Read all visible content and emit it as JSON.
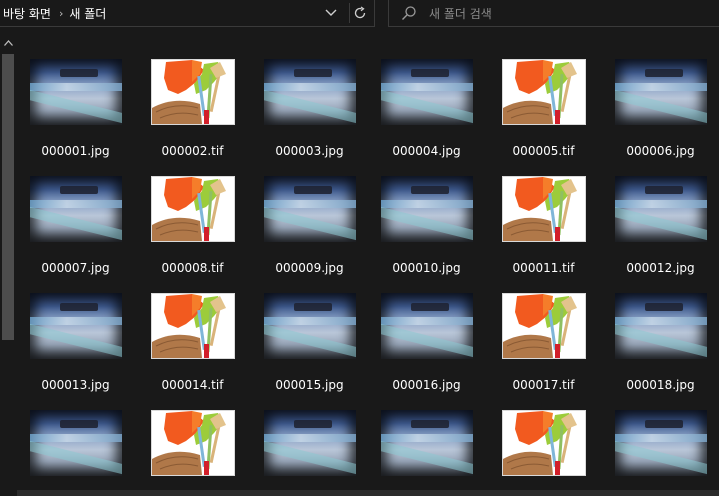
{
  "address": {
    "breadcrumbs": [
      "바탕 화면",
      "새 폴더"
    ],
    "separator": "›",
    "dropdown_icon": "chevron-down-icon",
    "refresh_icon": "refresh-icon"
  },
  "search": {
    "placeholder": "새 폴더 검색",
    "icon": "search-icon"
  },
  "files": [
    {
      "name": "000001.jpg",
      "type": "jpg"
    },
    {
      "name": "000002.tif",
      "type": "tif"
    },
    {
      "name": "000003.jpg",
      "type": "jpg"
    },
    {
      "name": "000004.jpg",
      "type": "jpg"
    },
    {
      "name": "000005.tif",
      "type": "tif"
    },
    {
      "name": "000006.jpg",
      "type": "jpg"
    },
    {
      "name": "000007.jpg",
      "type": "jpg"
    },
    {
      "name": "000008.tif",
      "type": "tif"
    },
    {
      "name": "000009.jpg",
      "type": "jpg"
    },
    {
      "name": "000010.jpg",
      "type": "jpg"
    },
    {
      "name": "000011.tif",
      "type": "tif"
    },
    {
      "name": "000012.jpg",
      "type": "jpg"
    },
    {
      "name": "000013.jpg",
      "type": "jpg"
    },
    {
      "name": "000014.tif",
      "type": "tif"
    },
    {
      "name": "000015.jpg",
      "type": "jpg"
    },
    {
      "name": "000016.jpg",
      "type": "jpg"
    },
    {
      "name": "000017.tif",
      "type": "tif"
    },
    {
      "name": "000018.jpg",
      "type": "jpg"
    },
    {
      "name": "",
      "type": "jpg"
    },
    {
      "name": "",
      "type": "tif"
    },
    {
      "name": "",
      "type": "jpg"
    },
    {
      "name": "",
      "type": "jpg"
    },
    {
      "name": "",
      "type": "tif"
    },
    {
      "name": "",
      "type": "jpg"
    }
  ],
  "colors": {
    "background": "#191919",
    "text": "#ffffff",
    "border": "#3a3a3a",
    "scroll_thumb": "#4d4d4d"
  }
}
